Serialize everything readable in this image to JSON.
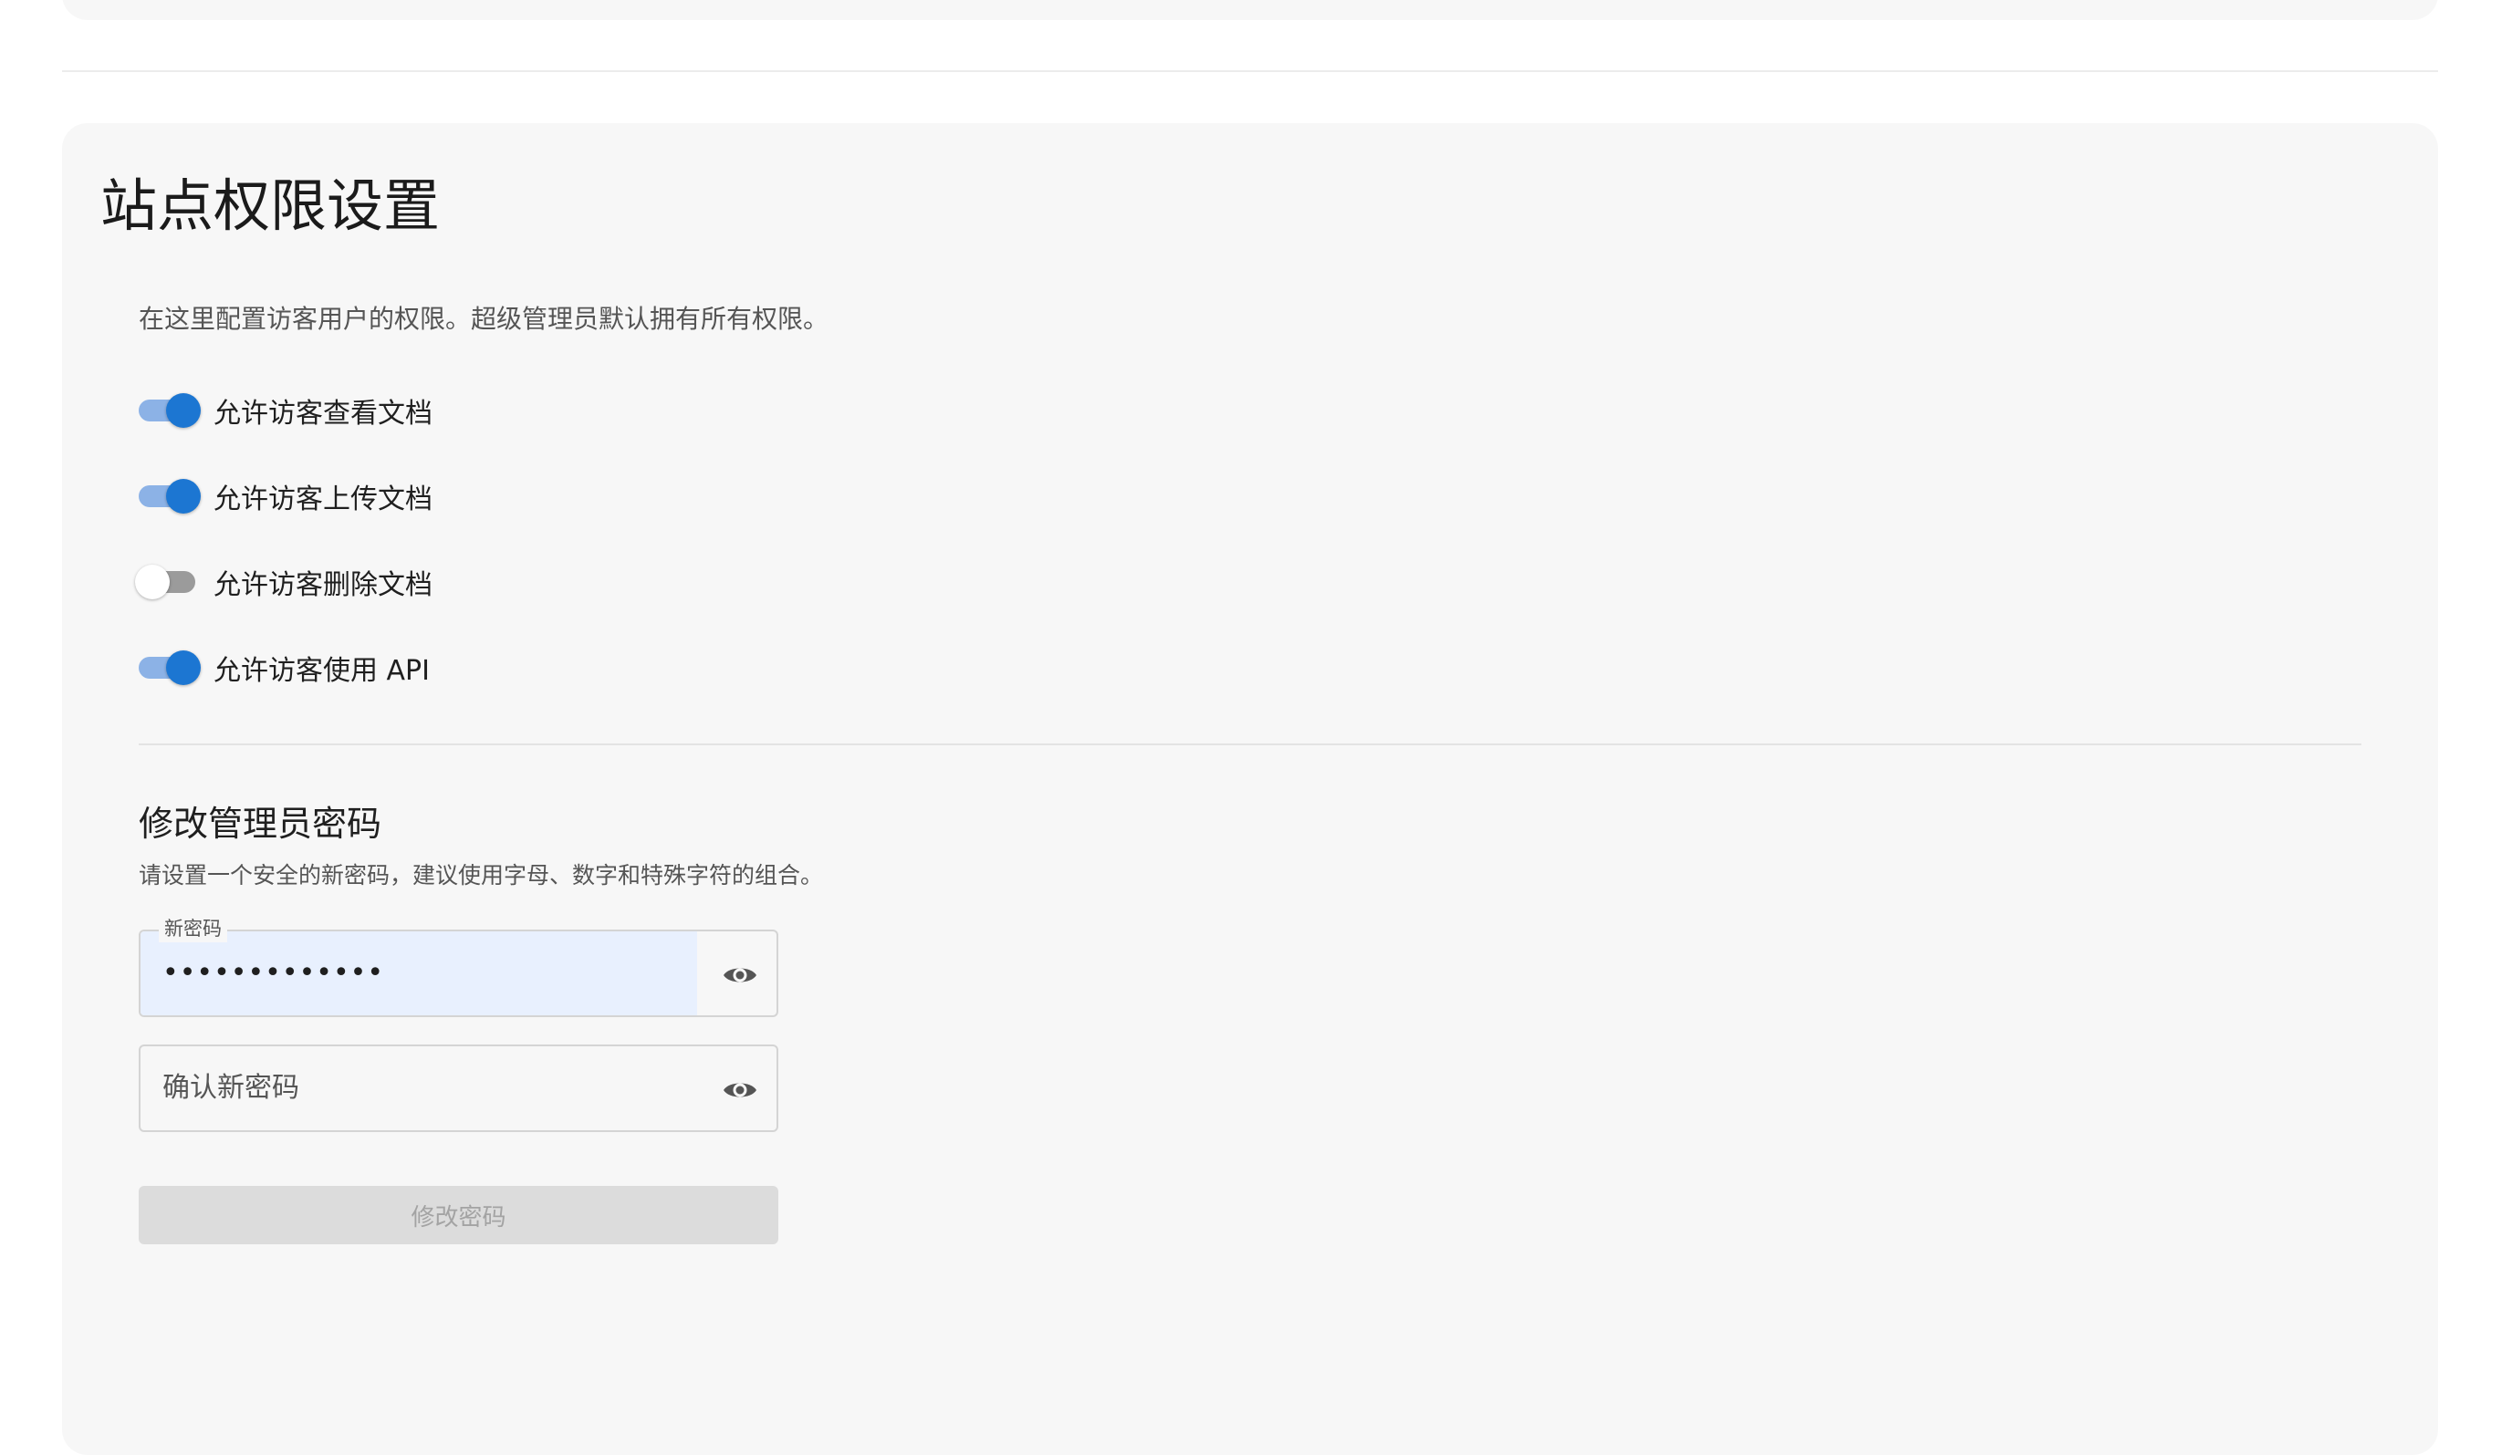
{
  "permissions": {
    "title": "站点权限设置",
    "description": "在这里配置访客用户的权限。超级管理员默认拥有所有权限。",
    "toggles": [
      {
        "label": "允许访客查看文档",
        "enabled": true
      },
      {
        "label": "允许访客上传文档",
        "enabled": true
      },
      {
        "label": "允许访客删除文档",
        "enabled": false
      },
      {
        "label": "允许访客使用 API",
        "enabled": true
      }
    ]
  },
  "password": {
    "title": "修改管理员密码",
    "description": "请设置一个安全的新密码，建议使用字母、数字和特殊字符的组合。",
    "new_password_label": "新密码",
    "new_password_value": "•••••••••••••",
    "confirm_placeholder": "确认新密码",
    "submit_label": "修改密码"
  },
  "colors": {
    "accent": "#1c76d2",
    "track_on": "#8cb2e6",
    "track_off": "#9b9b9b",
    "autofill_bg": "#e8f0fe",
    "card_bg": "#f7f7f7",
    "button_disabled_bg": "#dcdcdc"
  },
  "icons": {
    "visibility": "eye-icon"
  }
}
